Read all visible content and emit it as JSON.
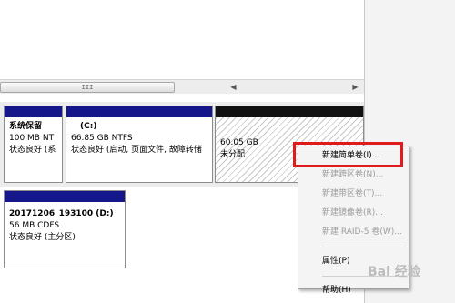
{
  "scrollbar": {
    "thumb_grip": "III"
  },
  "disk0": {
    "partitions": [
      {
        "name": "系统保留",
        "size": "100 MB NT",
        "status": "状态良好 (系"
      },
      {
        "name": "(C:)",
        "size": "66.85 GB NTFS",
        "status": "状态良好 (启动, 页面文件, 故障转储"
      },
      {
        "name": "",
        "size": "60.05 GB",
        "status": "未分配"
      }
    ]
  },
  "cdrom": {
    "name": "20171206_193100  (D:)",
    "size": "56 MB CDFS",
    "status": "状态良好 (主分区)"
  },
  "context_menu": {
    "items": [
      {
        "label": "新建简单卷(I)...",
        "enabled": true
      },
      {
        "label": "新建跨区卷(N)...",
        "enabled": false
      },
      {
        "label": "新建带区卷(T)...",
        "enabled": false
      },
      {
        "label": "新建镜像卷(R)...",
        "enabled": false
      },
      {
        "label": "新建 RAID-5 卷(W)...",
        "enabled": false
      },
      {
        "label": "属性(P)",
        "enabled": true
      },
      {
        "label": "帮助(H)",
        "enabled": true
      }
    ]
  },
  "colors": {
    "partition_bar": "#15168a",
    "unallocated_bar": "#111111",
    "highlight_box": "#e01b1b"
  },
  "watermark": "Bai 经验"
}
